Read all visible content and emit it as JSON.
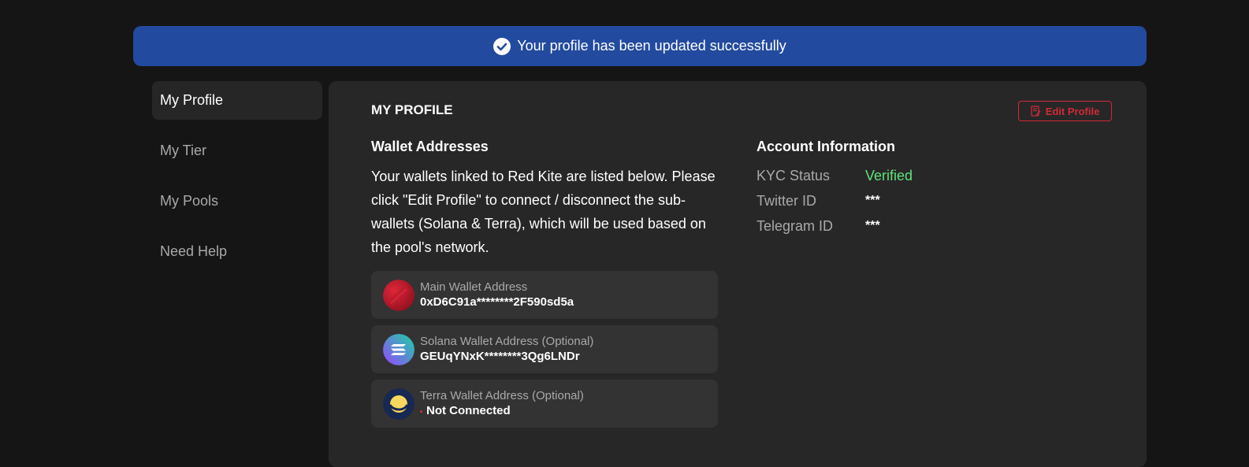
{
  "banner": {
    "message": "Your profile has been updated successfully"
  },
  "sidebar": {
    "items": [
      {
        "label": "My Profile",
        "active": true
      },
      {
        "label": "My Tier"
      },
      {
        "label": "My Pools"
      },
      {
        "label": "Need Help"
      }
    ]
  },
  "profile": {
    "title": "MY PROFILE",
    "edit_label": "Edit Profile",
    "wallets_title": "Wallet Addresses",
    "wallets_desc": "Your wallets linked to Red Kite are listed below. Please click \"Edit Profile\" to connect / disconnect the sub-wallets (Solana & Terra), which will be used based on the pool's network.",
    "wallets": [
      {
        "label": "Main Wallet Address",
        "value": "0xD6C91a********2F590sd5a",
        "icon": "red-kite-icon"
      },
      {
        "label": "Solana Wallet Address (Optional)",
        "value": "GEUqYNxK********3Qg6LNDr",
        "icon": "solana-icon"
      },
      {
        "label": "Terra Wallet Address (Optional)",
        "value": "Not Connected",
        "icon": "terra-icon"
      }
    ],
    "account_title": "Account Information",
    "account": [
      {
        "key": "KYC Status",
        "value": "Verified"
      },
      {
        "key": "Twitter ID",
        "value": "***"
      },
      {
        "key": "Telegram ID",
        "value": "***"
      }
    ]
  },
  "colors": {
    "banner": "#224a9e",
    "accent_red": "#d12a36",
    "verified_green": "#5ee37a"
  }
}
